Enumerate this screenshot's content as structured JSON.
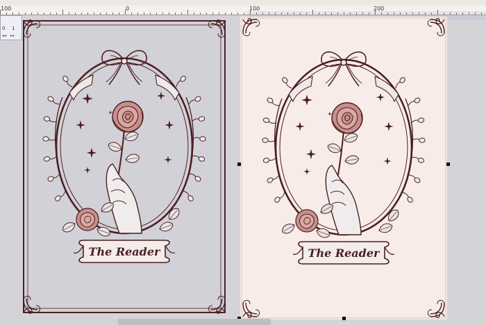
{
  "ruler": {
    "labels": [
      "100",
      "0",
      "100",
      "200"
    ]
  },
  "mini_panel": {
    "cell_a": "0",
    "cell_b": "1",
    "arrows": "↔ ↔"
  },
  "design": {
    "banner_text": "The Reader"
  },
  "colors": {
    "workspace": "#d5d3d8",
    "left_card": "#d2d1d7",
    "right_card": "#f7ece8",
    "ink": "#4a1f22",
    "rose": "#c98f8a",
    "ruler_bg": "#f4f2ee"
  },
  "icons": [
    "bow-icon",
    "rose-icon",
    "hand-icon",
    "sparkle-icon",
    "corner-flourish-icon"
  ]
}
